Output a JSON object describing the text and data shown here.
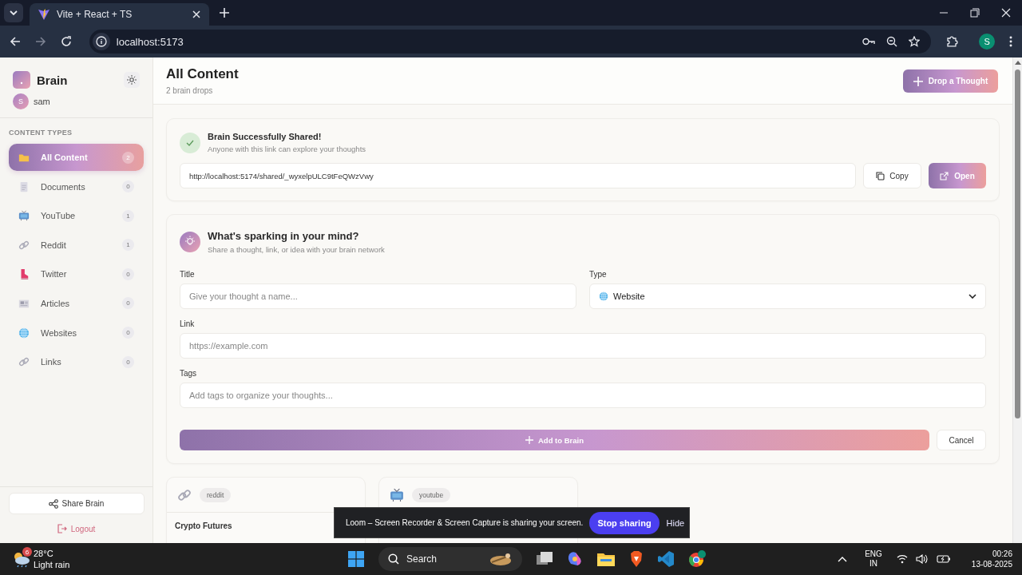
{
  "browser": {
    "tab_title": "Vite + React + TS",
    "url": "localhost:5173",
    "profile_initial": "S"
  },
  "sidebar": {
    "brand": "Brain",
    "user": {
      "initial": "S",
      "name": "sam"
    },
    "section_label": "CONTENT TYPES",
    "items": [
      {
        "label": "All Content",
        "count": "2",
        "kind": "folder",
        "selected": true
      },
      {
        "label": "Documents",
        "count": "0",
        "kind": "document",
        "selected": false
      },
      {
        "label": "YouTube",
        "count": "1",
        "kind": "tv",
        "selected": false
      },
      {
        "label": "Reddit",
        "count": "1",
        "kind": "link",
        "selected": false
      },
      {
        "label": "Twitter",
        "count": "0",
        "kind": "boot",
        "selected": false
      },
      {
        "label": "Articles",
        "count": "0",
        "kind": "newspaper",
        "selected": false
      },
      {
        "label": "Websites",
        "count": "0",
        "kind": "globe",
        "selected": false
      },
      {
        "label": "Links",
        "count": "0",
        "kind": "link",
        "selected": false
      }
    ],
    "share_button": "Share Brain",
    "logout": "Logout"
  },
  "header": {
    "title": "All Content",
    "subtitle": "2 brain drops",
    "action": "Drop a Thought"
  },
  "share_panel": {
    "title": "Brain Successfully Shared!",
    "subtitle": "Anyone with this link can explore your thoughts",
    "link": "http://localhost:5174/shared/_wyxelpULC9tFeQWzVwy",
    "copy": "Copy",
    "open": "Open"
  },
  "form": {
    "title": "What's sparking in your mind?",
    "subtitle": "Share a thought, link, or idea with your brain network",
    "fields": [
      {
        "label": "Title",
        "kind": "text",
        "placeholder": "Give your thought a name..."
      },
      {
        "label": "Type",
        "kind": "select",
        "value": "Website"
      },
      {
        "label": "Link",
        "kind": "text",
        "placeholder": "https://example.com"
      },
      {
        "label": "Tags",
        "kind": "text",
        "placeholder": "Add tags to organize your thoughts..."
      }
    ],
    "submit": "Add to Brain",
    "cancel": "Cancel"
  },
  "cards": [
    {
      "kind": "link",
      "tag": "reddit",
      "title": "Crypto Futures"
    },
    {
      "kind": "tv",
      "tag": "youtube"
    }
  ],
  "loom": {
    "message": "Loom – Screen Recorder & Screen Capture is sharing your screen.",
    "stop": "Stop sharing",
    "hide": "Hide"
  },
  "taskbar": {
    "weather_badge": "6",
    "temperature": "28°C",
    "condition": "Light rain",
    "search": "Search",
    "language": "ENG",
    "region": "IN",
    "time": "00:26",
    "date": "13-08-2025"
  }
}
